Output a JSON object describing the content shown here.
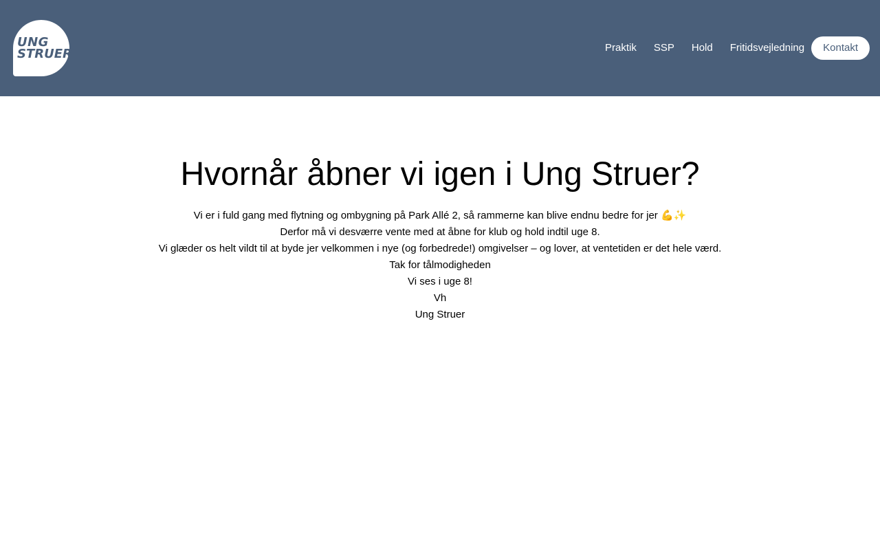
{
  "header": {
    "logo": {
      "line1": "UNG",
      "line2": "STRUER"
    },
    "nav": {
      "items": [
        {
          "label": "Praktik"
        },
        {
          "label": "SSP"
        },
        {
          "label": "Hold"
        },
        {
          "label": "Fritidsvejledning"
        }
      ],
      "cta_label": "Kontakt"
    }
  },
  "main": {
    "title": "Hvornår åbner vi igen i Ung Struer?",
    "paragraphs": [
      "Vi er i fuld gang med flytning og ombygning på Park Allé 2, så rammerne kan blive endnu bedre for jer 💪✨",
      "Derfor må vi desværre vente med at åbne for klub og hold indtil uge 8.",
      "Vi glæder os helt vildt til at byde jer velkommen i nye (og forbedrede!) omgivelser – og lover, at ventetiden er det hele værd.",
      "Tak for tålmodigheden",
      "Vi ses i uge 8!",
      "Vh",
      "Ung Struer"
    ]
  },
  "colors": {
    "header_bg": "#4a5f7a",
    "header_text": "#ffffff",
    "cta_bg": "#ffffff",
    "cta_text": "#4a5f7a"
  }
}
